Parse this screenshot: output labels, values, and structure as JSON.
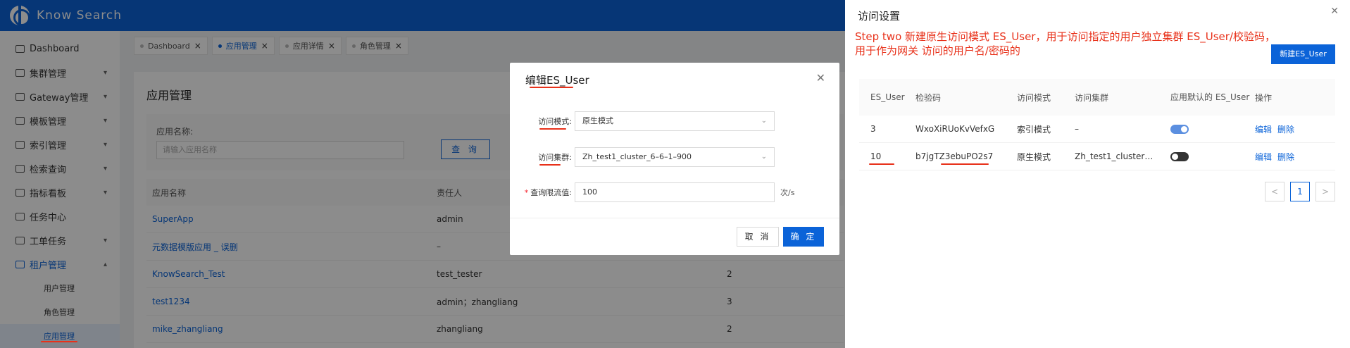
{
  "app": {
    "title": "Know  Search"
  },
  "sidebar": {
    "items": [
      {
        "label": "Dashboard",
        "has_children": false
      },
      {
        "label": "集群管理",
        "has_children": true
      },
      {
        "label": "Gateway管理",
        "has_children": true
      },
      {
        "label": "模板管理",
        "has_children": true
      },
      {
        "label": "索引管理",
        "has_children": true
      },
      {
        "label": "检索查询",
        "has_children": true
      },
      {
        "label": "指标看板",
        "has_children": true
      },
      {
        "label": "任务中心",
        "has_children": false
      },
      {
        "label": "工单任务",
        "has_children": true
      },
      {
        "label": "租户管理",
        "has_children": true,
        "open": true
      }
    ],
    "subitems": [
      "用户管理",
      "角色管理",
      "应用管理"
    ]
  },
  "tabs": [
    {
      "label": "Dashboard",
      "active": false
    },
    {
      "label": "应用管理",
      "active": true
    },
    {
      "label": "应用详情",
      "active": false
    },
    {
      "label": "角色管理",
      "active": false
    }
  ],
  "main": {
    "title": "应用管理",
    "filter_label": "应用名称:",
    "filter_placeholder": "请输入应用名称",
    "query_button": "查 询",
    "columns": [
      "应用名称",
      "责任人",
      ""
    ],
    "rows": [
      [
        "SuperApp",
        "admin",
        ""
      ],
      [
        "元数据模版应用 _ 误删",
        "–",
        ""
      ],
      [
        "KnowSearch_Test",
        "test_tester",
        "2"
      ],
      [
        "test1234",
        "admin；zhangliang",
        "3"
      ],
      [
        "mike_zhangliang",
        "zhangliang",
        "2"
      ]
    ]
  },
  "modal": {
    "title": "编辑ES_User",
    "access_mode_label": "访问模式:",
    "access_mode_value": "原生模式",
    "access_cluster_label": "访问集群:",
    "access_cluster_value": "Zh_test1_cluster_6–6–1–900",
    "rate_limit_label": "查询限流值:",
    "rate_limit_value": "100",
    "rate_limit_unit": "次/s",
    "cancel": "取 消",
    "ok": "确 定"
  },
  "drawer": {
    "title": "访问设置",
    "annotation": "Step two  新建原生访问模式 ES_User，用于访问指定的用户独立集群 ES_User/校验码，用于作为网关 访问的用户名/密码的",
    "new_button": "新建ES_User",
    "columns": [
      "ES_User",
      "检验码",
      "访问模式",
      "访问集群",
      "应用默认的 ES_User",
      "操作"
    ],
    "rows": [
      {
        "es_user": "3",
        "code": "WxoXiRUoKvVefxG",
        "mode": "索引模式",
        "cluster": "–",
        "default_on": true,
        "edit": "编辑",
        "delete": "删除"
      },
      {
        "es_user": "10",
        "code": "b7jgTZ3ebuPO2s7",
        "mode": "原生模式",
        "cluster": "Zh_test1_cluster…",
        "default_on": false,
        "edit": "编辑",
        "delete": "删除"
      }
    ],
    "pagination": {
      "prev": "<",
      "current": "1",
      "next": ">"
    }
  },
  "colors": {
    "primary": "#0b63d8",
    "annotation": "#e8311a",
    "danger": "#f5222d"
  }
}
